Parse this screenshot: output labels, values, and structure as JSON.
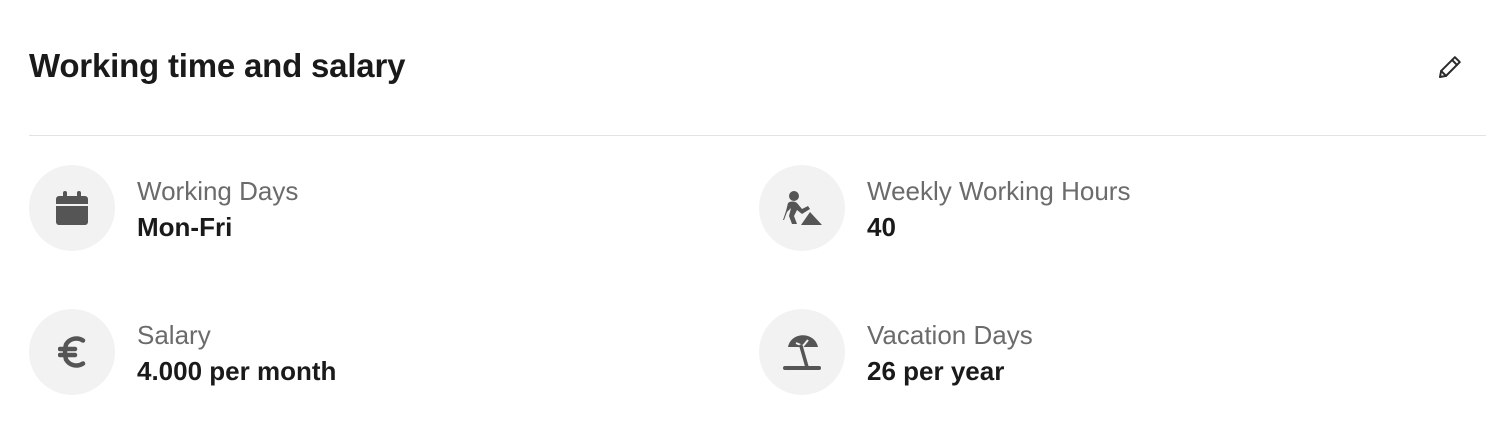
{
  "section": {
    "title": "Working time and salary",
    "edit_icon": "pencil-icon"
  },
  "items": [
    {
      "icon": "calendar-icon",
      "label": "Working Days",
      "value": "Mon-Fri"
    },
    {
      "icon": "worker-digging-icon",
      "label": "Weekly Working Hours",
      "value": "40"
    },
    {
      "icon": "euro-icon",
      "label": "Salary",
      "value": "4.000 per month"
    },
    {
      "icon": "beach-umbrella-icon",
      "label": "Vacation Days",
      "value": "26 per year"
    }
  ],
  "colors": {
    "icon": "#555555",
    "icon_background": "#f2f2f2",
    "label": "#6b6b6b",
    "value": "#1a1a1a",
    "divider": "#e2e2e2"
  }
}
